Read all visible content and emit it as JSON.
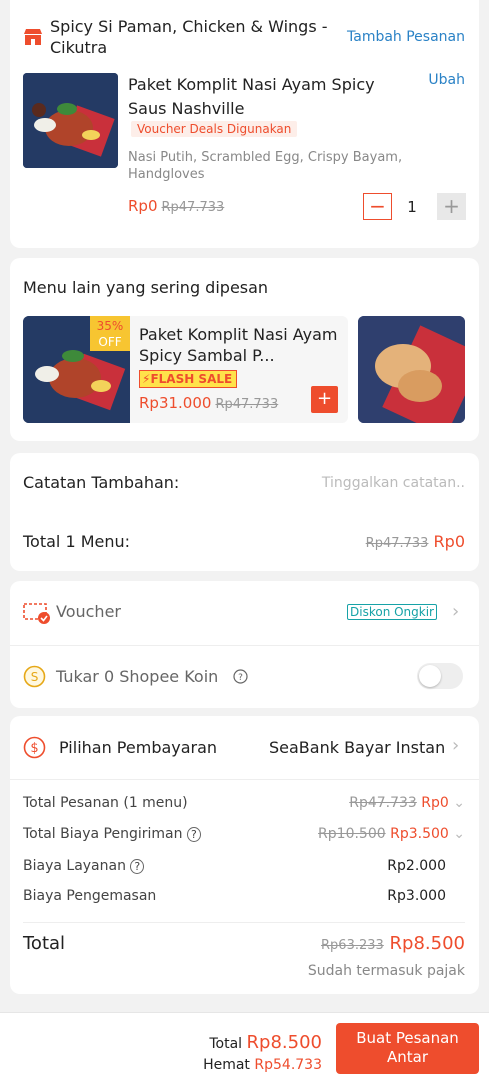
{
  "store": {
    "name": "Spicy Si Paman, Chicken & Wings - Cikutra",
    "add_order_label": "Tambah Pesanan"
  },
  "cart_item": {
    "name": "Paket Komplit Nasi Ayam Spicy Saus Nashville",
    "edit_label": "Ubah",
    "voucher_tag": "Voucher Deals Digunakan",
    "description": "Nasi Putih, Scrambled Egg, Crispy Bayam, Handgloves",
    "price": "Rp0",
    "original_price": "Rp47.733",
    "quantity": "1"
  },
  "recommendations": {
    "title": "Menu lain yang sering dipesan",
    "items": [
      {
        "discount": "35%",
        "discount_off": "OFF",
        "name": "Paket Komplit Nasi Ayam Spicy Sambal P...",
        "flash_label": "FLASH SALE",
        "price": "Rp31.000",
        "original_price": "Rp47.733"
      }
    ]
  },
  "notes": {
    "label": "Catatan Tambahan:",
    "placeholder": "Tinggalkan catatan.."
  },
  "total_menu": {
    "label": "Total 1 Menu:",
    "original": "Rp47.733",
    "value": "Rp0"
  },
  "voucher": {
    "label": "Voucher",
    "badge": "Diskon Ongkir"
  },
  "coins": {
    "label": "Tukar 0 Shopee Koin",
    "enabled": false
  },
  "payment": {
    "label": "Pilihan Pembayaran",
    "method": "SeaBank Bayar Instan"
  },
  "summary": {
    "order_total_label": "Total Pesanan (1 menu)",
    "order_total_original": "Rp47.733",
    "order_total_value": "Rp0",
    "shipping_label": "Total Biaya Pengiriman",
    "shipping_original": "Rp10.500",
    "shipping_value": "Rp3.500",
    "service_label": "Biaya Layanan",
    "service_value": "Rp2.000",
    "packaging_label": "Biaya Pengemasan",
    "packaging_value": "Rp3.000",
    "total_label": "Total",
    "total_original": "Rp63.233",
    "total_value": "Rp8.500",
    "tax_note": "Sudah termasuk pajak"
  },
  "bottom": {
    "total_label": "Total",
    "total_value": "Rp8.500",
    "savings_label": "Hemat",
    "savings_value": "Rp54.733",
    "order_button": "Buat Pesanan Antar"
  },
  "colors": {
    "accent": "#ee4d2d",
    "link": "#2a82c6",
    "voucher_badge": "#17a2a7"
  }
}
